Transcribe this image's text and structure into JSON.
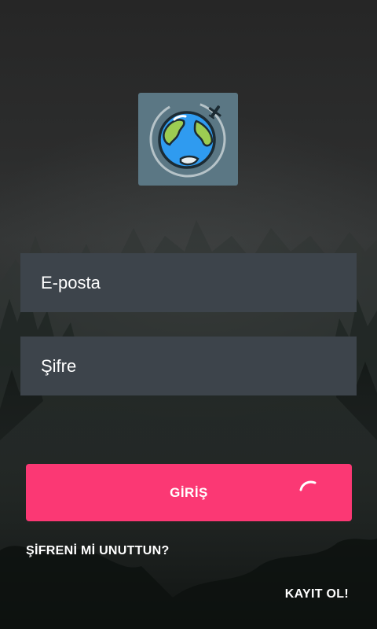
{
  "logo": {
    "icon": "globe-with-airplane-icon",
    "background_color": "#5b7784",
    "ocean_color": "#2f9bf0",
    "land_color": "#9ccc52"
  },
  "form": {
    "email_placeholder": "E-posta",
    "password_placeholder": "Şifre"
  },
  "login_button": {
    "label": "GİRİŞ",
    "color": "#fb3874",
    "loading": true
  },
  "forgot_password_label": "ŞİFRENİ Mİ UNUTTUN?",
  "register_label": "KAYIT OL!"
}
